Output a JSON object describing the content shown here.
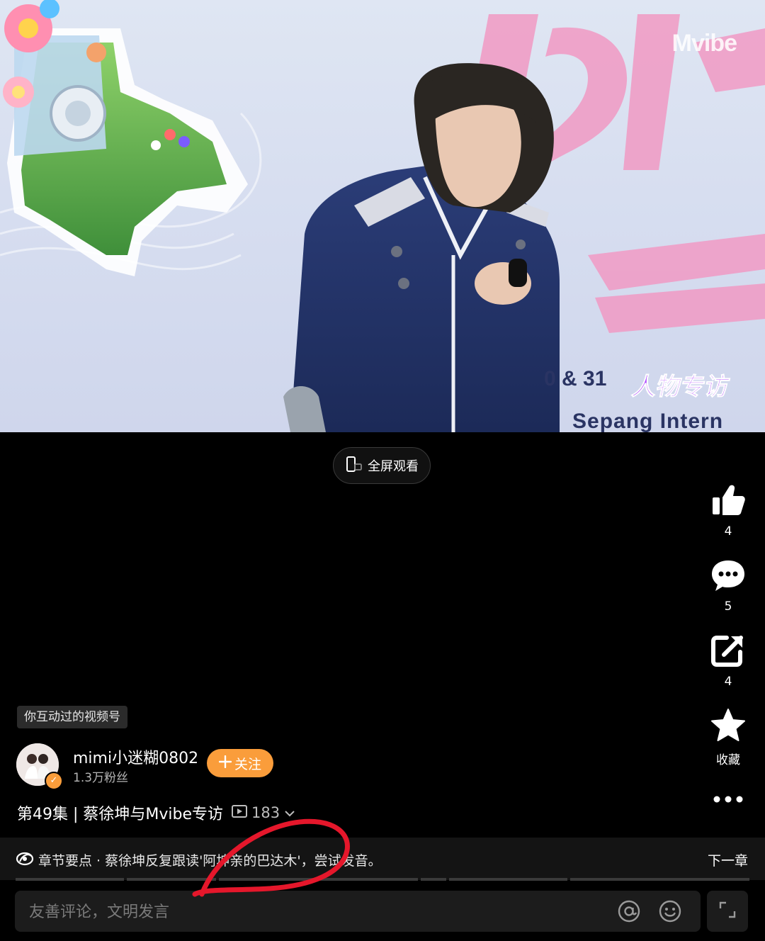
{
  "video": {
    "watermark": "Mvibe",
    "overlay_tag": "人物专访",
    "date_text": "0 & 31",
    "venue_text": "Sepang Intern"
  },
  "fullscreen": {
    "label": "全屏观看",
    "icon": "phone-landscape-icon"
  },
  "actions": {
    "like": {
      "icon": "thumbs-up-icon",
      "count": "4"
    },
    "comment": {
      "icon": "comment-bubble-icon",
      "count": "5"
    },
    "share": {
      "icon": "share-icon",
      "count": "4"
    },
    "favorite": {
      "icon": "star-icon",
      "label": "收藏"
    },
    "more": {
      "icon": "more-dots-icon"
    }
  },
  "badge": "你互动过的视频号",
  "author": {
    "name": "mimi小迷糊0802",
    "fans": "1.3万粉丝",
    "follow_label": "关注",
    "follow_icon": "plus-icon"
  },
  "post": {
    "title": "第49集 | 蔡徐坤与Mvibe专访",
    "views": "183"
  },
  "chapter": {
    "icon": "chapter-icon",
    "text": "章节要点 · 蔡徐坤反复跟读'阿坤亲的巴达木'，尝试发音。",
    "next_label": "下一章"
  },
  "comment": {
    "placeholder": "友善评论，文明发言",
    "mention_icon": "at-icon",
    "emoji_icon": "emoji-icon",
    "expand_icon": "expand-icon"
  },
  "colors": {
    "accent": "#fa9d3b",
    "annotation": "#e5172b"
  }
}
